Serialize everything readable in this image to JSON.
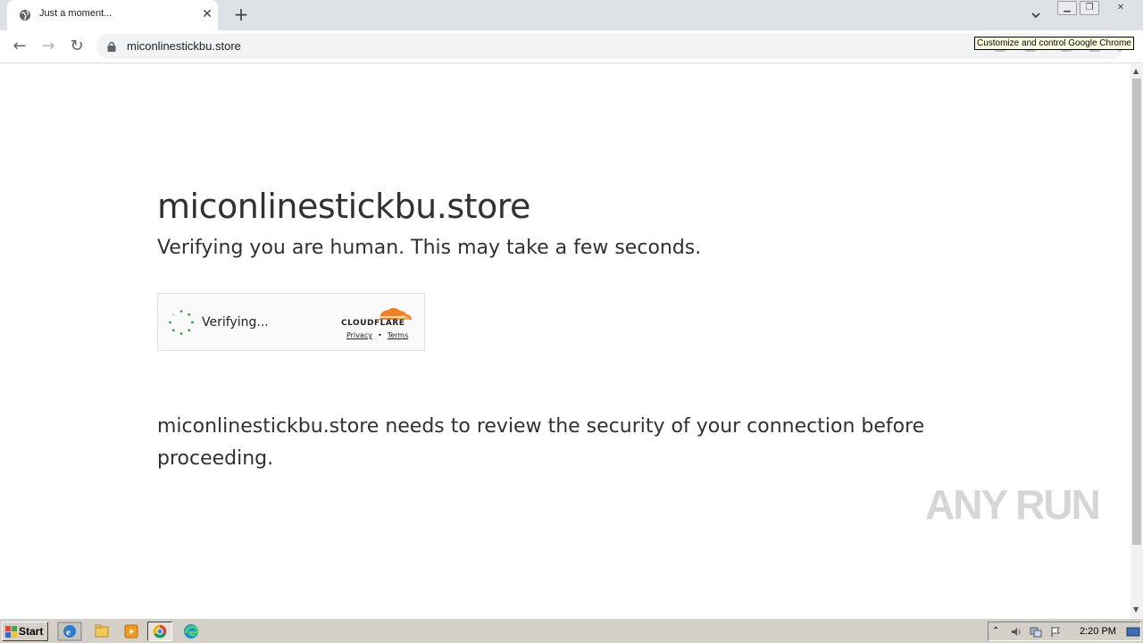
{
  "browser": {
    "tab_title": "Just a moment...",
    "tab_close_glyph": "✕",
    "new_tab_glyph": "+",
    "url": "miconlinestickbu.store",
    "tooltip": "Customize and control Google Chrome",
    "back_glyph": "←",
    "forward_glyph": "→",
    "reload_glyph": "↻"
  },
  "page": {
    "heading": "miconlinestickbu.store",
    "subheading": "Verifying you are human. This may take a few seconds.",
    "widget": {
      "status": "Verifying...",
      "brand": "CLOUDFLARE",
      "privacy_link": "Privacy",
      "separator": "•",
      "terms_link": "Terms"
    },
    "body": "miconlinestickbu.store needs to review the security of your connection before proceeding.",
    "watermark": "ANY RUN"
  },
  "taskbar": {
    "start_label": "Start",
    "clock": "2:20 PM",
    "apps": [
      "internet-explorer-icon",
      "file-explorer-icon",
      "media-player-icon",
      "chrome-icon",
      "edge-icon"
    ]
  },
  "colors": {
    "accent_orange": "#f48120",
    "spinner_green": "#2fa34b",
    "text": "#313131"
  }
}
